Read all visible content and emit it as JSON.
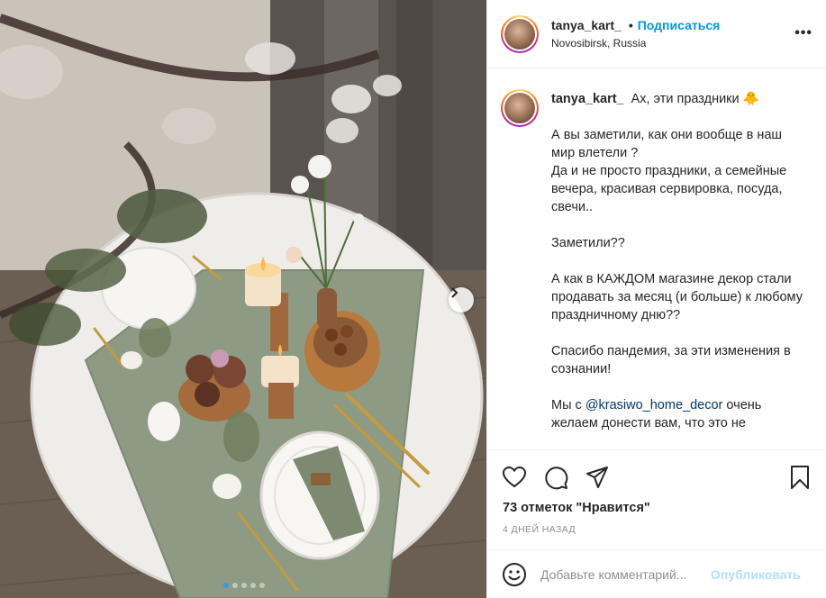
{
  "post": {
    "username": "tanya_kart_",
    "follow_label": "Подписаться",
    "separator": "•",
    "location": "Novosibirsk, Russia",
    "more_label": "•••"
  },
  "caption": {
    "username": "tanya_kart_",
    "title": "Ах, эти праздники 🐥",
    "paragraphs": [
      "А вы заметили, как они вообще в наш мир влетели ?\nДа и не просто праздники, а семейные вечера, красивая сервировка, посуда, свечи..",
      "Заметили??",
      "А как в КАЖДОМ магазине декор стали продавать за месяц (и больше) к любому праздничному дню??",
      "Спасибо пандемия, за эти изменения в сознании!"
    ],
    "last_before": "Мы с ",
    "mention": "@krasiwo_home_decor",
    "last_after": " очень желаем донести вам, что это не"
  },
  "actions": {
    "likes": "73 отметок \"Нравится\"",
    "time": "4 ДНЕЙ НАЗАД"
  },
  "comment_box": {
    "placeholder": "Добавьте комментарий...",
    "post_label": "Опубликовать"
  },
  "icons": {
    "like": "heart-icon",
    "comment": "comment-icon",
    "share": "share-icon",
    "save": "bookmark-icon",
    "emoji": "emoji-icon",
    "next": "chevron-right-icon"
  },
  "carousel": {
    "count": 5,
    "active": 1
  },
  "colors": {
    "link": "#0095f6",
    "mention": "#00376b",
    "muted": "#8e8e8e",
    "post_disabled": "#b2dffc",
    "carousel_active": "#3897f0"
  }
}
